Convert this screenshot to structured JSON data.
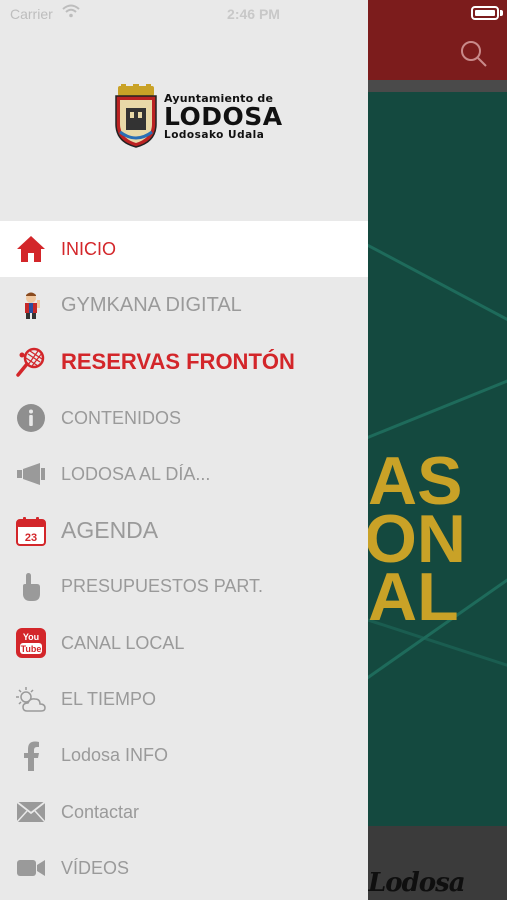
{
  "status_bar": {
    "carrier": "Carrier",
    "time": "2:46 PM"
  },
  "logo": {
    "line1": "Ayuntamiento de",
    "line2": "LODOSA",
    "line3": "Lodosako Udala"
  },
  "background": {
    "banner_text": [
      "AS",
      "ON",
      "AL"
    ],
    "footer_text": "Lodosa"
  },
  "menu": {
    "items": [
      {
        "label": "INICIO",
        "icon": "home-icon",
        "active": true
      },
      {
        "label": "GYMKANA DIGITAL",
        "icon": "gymkana-character-icon"
      },
      {
        "label": "RESERVAS FRONTÓN",
        "icon": "racket-icon"
      },
      {
        "label": "CONTENIDOS",
        "icon": "info-icon"
      },
      {
        "label": "LODOSA AL DÍA...",
        "icon": "megaphone-icon"
      },
      {
        "label": "AGENDA",
        "icon": "calendar-icon",
        "calendar_day": "23"
      },
      {
        "label": "PRESUPUESTOS PART.",
        "icon": "pointer-hand-icon"
      },
      {
        "label": "CANAL LOCAL",
        "icon": "youtube-icon",
        "badge_top": "You",
        "badge_bottom": "Tube"
      },
      {
        "label": "EL TIEMPO",
        "icon": "weather-icon"
      },
      {
        "label": "Lodosa INFO",
        "icon": "facebook-icon"
      },
      {
        "label": "Contactar",
        "icon": "mail-icon"
      },
      {
        "label": "VÍDEOS",
        "icon": "video-camera-icon"
      }
    ]
  },
  "colors": {
    "accent_red": "#d3262a",
    "drawer_bg": "#e9e9e9",
    "active_bg": "#ffffff",
    "inactive_text": "#9a9a9a",
    "header_red": "#7c1c1c",
    "banner_green": "#14493f",
    "banner_yellow": "#c9a227"
  }
}
